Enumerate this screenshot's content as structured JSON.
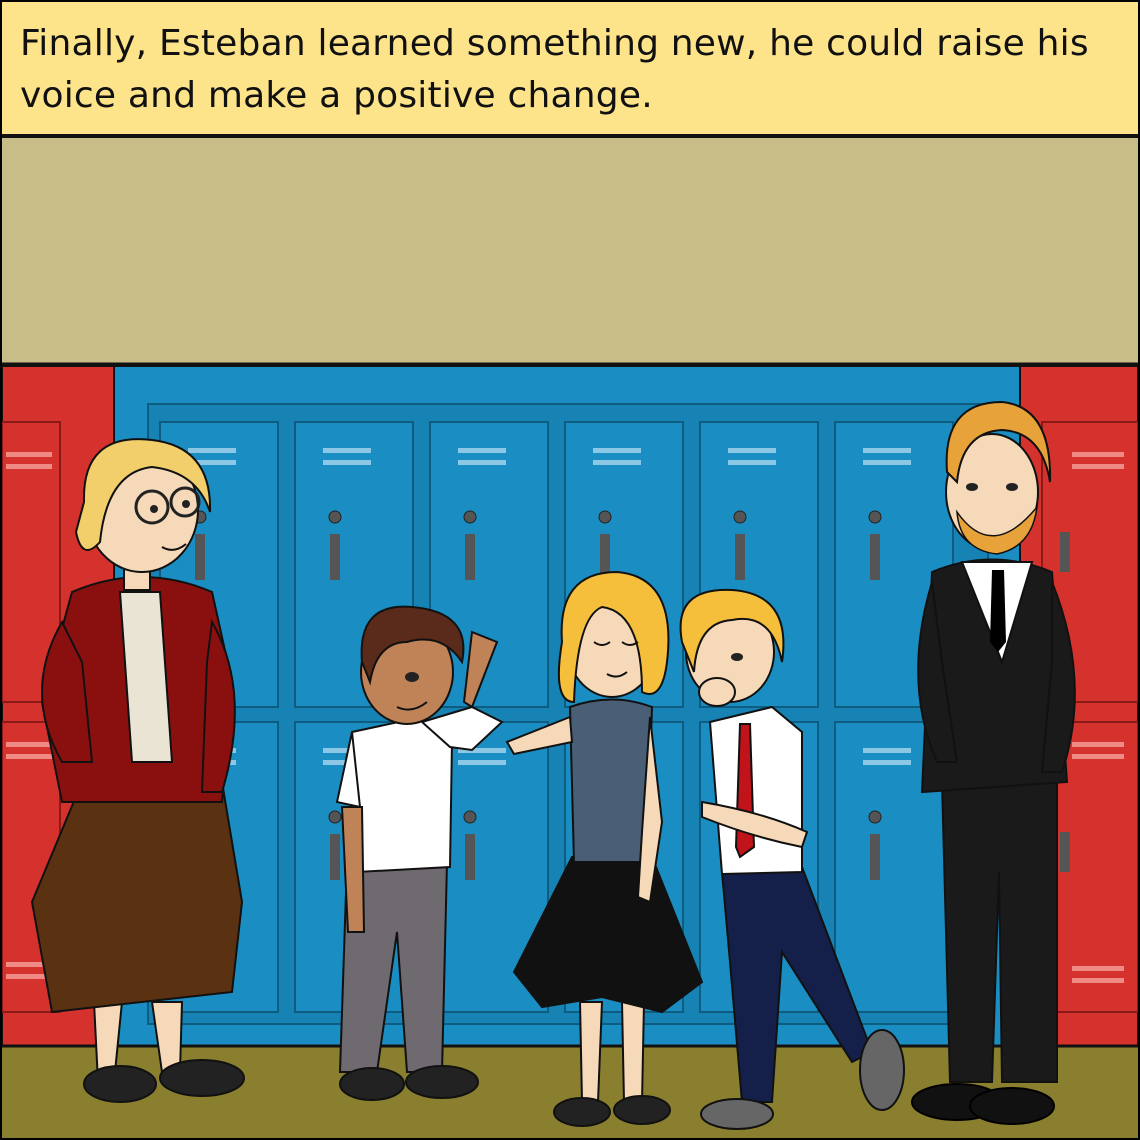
{
  "caption": {
    "text": "Finally, Esteban learned something new, he could raise his voice and make a positive change."
  },
  "scene": {
    "setting": "school-hallway-lockers",
    "colors": {
      "caption_bg": "#fde38a",
      "wall": "#c8bd86",
      "blue_lockers": "#1a8ec2",
      "red_lockers": "#d6322d",
      "floor": "#8a7f2e"
    },
    "characters": [
      {
        "name": "teacher-woman",
        "palette": {
          "jacket": "#8a1010",
          "skirt": "#5a3212",
          "hair": "#f2cf6a"
        }
      },
      {
        "name": "esteban",
        "palette": {
          "shirt": "#ffffff",
          "pants": "#6f6a70",
          "hair": "#5a2a1a"
        }
      },
      {
        "name": "girl",
        "palette": {
          "top": "#4a5f76",
          "skirt": "#111111",
          "hair": "#f5bf3c"
        }
      },
      {
        "name": "boy-blond",
        "palette": {
          "shirt": "#ffffff",
          "pants": "#15204a",
          "tie": "#c0141a"
        }
      },
      {
        "name": "principal-man",
        "palette": {
          "suit": "#1a1a1a",
          "hair": "#e8a23a"
        }
      }
    ]
  }
}
